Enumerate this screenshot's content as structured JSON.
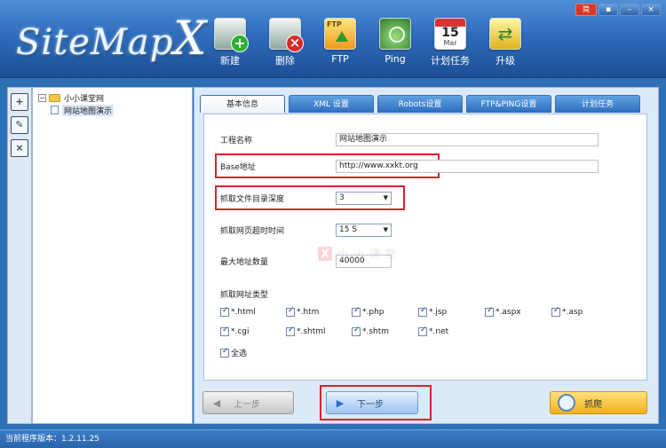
{
  "app": {
    "logo_text": "SiteMap",
    "logo_x": "X",
    "lang_label": "简",
    "window_controls": [
      "▪",
      "–",
      "×"
    ]
  },
  "toolbar": {
    "new_label": "新建",
    "delete_label": "删除",
    "ftp_label": "FTP",
    "ping_label": "Ping",
    "schedule_label": "计划任务",
    "calendar_day": "15",
    "calendar_month": "Mar",
    "upgrade_label": "升级"
  },
  "sidebar_tools": [
    "new-project-icon",
    "edit-project-icon",
    "delete-project-icon"
  ],
  "tree": {
    "root_toggle": "−",
    "root_label": "小小课堂网",
    "child_label": "网站地图演示"
  },
  "tabs": [
    "基本信息",
    "XML 设置",
    "Robots设置",
    "FTP&PING设置",
    "计划任务"
  ],
  "form": {
    "project_name_label": "工程名称",
    "project_name_value": "网站地图演示",
    "base_url_label": "Base地址",
    "base_url_value": "http://www.xxkt.org",
    "depth_label": "抓取文件目录深度",
    "depth_value": "3",
    "timeout_label": "抓取网页超时时间",
    "timeout_value": "15 S",
    "max_urls_label": "最大地址数量",
    "max_urls_value": "40000",
    "types_label": "抓取网址类型",
    "types": [
      "*.html",
      "*.htm",
      "*.php",
      "*.jsp",
      "*.aspx",
      "*.asp",
      "*.cgi",
      "*.shtml",
      "*.shtm",
      "*.net"
    ],
    "select_all_label": "全选"
  },
  "watermark": {
    "icon_text": "X",
    "text": "小小课堂"
  },
  "buttons": {
    "prev_label": "上一步",
    "next_label": "下一步",
    "crawl_label": "抓爬"
  },
  "status": {
    "version_text": "当前程序版本：1.2.11.25"
  }
}
